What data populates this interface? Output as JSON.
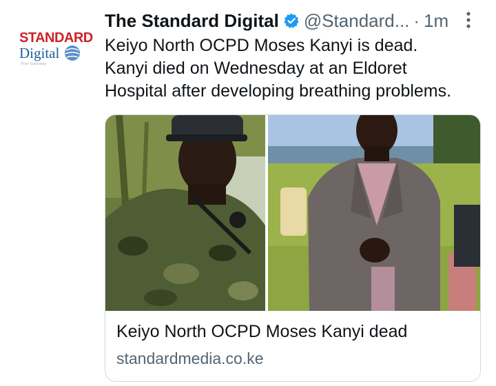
{
  "avatar": {
    "brand_line1": "STANDARD",
    "brand_line2": "Digital",
    "tagline": "Your Gateway",
    "icon": "standard-digital-logo"
  },
  "header": {
    "display_name": "The Standard Digital",
    "handle": "@Standard...",
    "separator": "·",
    "time": "1m",
    "verified_icon": "verified-badge-icon",
    "more_icon": "more-vertical-icon"
  },
  "tweet": {
    "lines": [
      "Keiyo North OCPD Moses Kanyi is dead.",
      "Kanyi died on Wednesday at an Eldoret",
      "Hospital after developing breathing problems."
    ]
  },
  "card": {
    "title": "Keiyo North OCPD Moses Kanyi dead",
    "domain": "standardmedia.co.ke"
  },
  "colors": {
    "brand_red": "#cc2229",
    "brand_blue": "#1f5b99",
    "verified_blue": "#1d9bf0",
    "secondary_text": "#536471",
    "border": "#cfd9de"
  }
}
